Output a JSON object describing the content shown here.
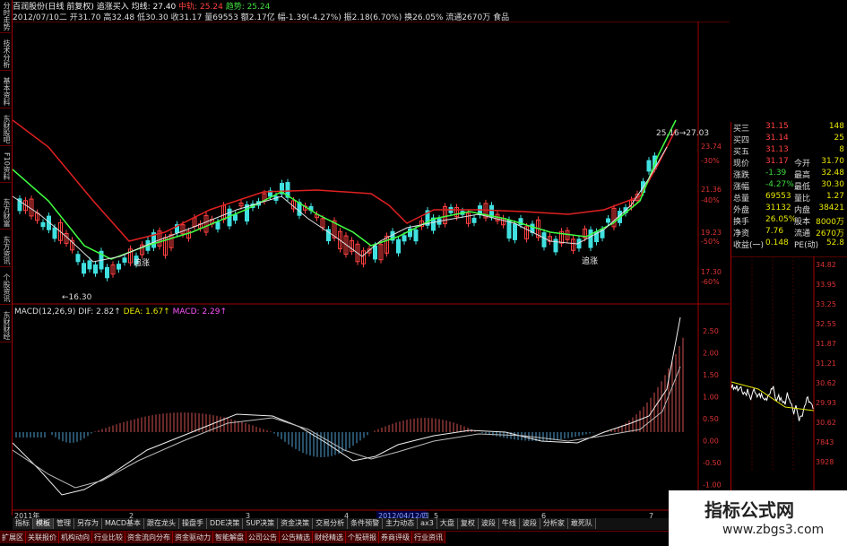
{
  "left_toolbar": [
    "分时走势",
    "技术分析",
    "基本资料",
    "东财股吧",
    "F10资料",
    "东方财富",
    "东方资讯",
    "个股资讯",
    "东财财经"
  ],
  "header": {
    "line1_parts": [
      {
        "text": "百润股份(日线 前复权)",
        "cls": "white"
      },
      {
        "text": " 追涨买入 ",
        "cls": "white"
      },
      {
        "text": "均线: 27.40",
        "cls": "white"
      },
      {
        "text": " 中轨: 25.24",
        "cls": "red"
      },
      {
        "text": " 趋势: 25.24",
        "cls": "green"
      }
    ],
    "line2": "2012/07/10二 开31.70 高32.48 低30.30 收31.17 量69553 额2.17亿 幅-1.39(-4.27%) 振2.18(6.70%) 换26.05% 流通2670万 食品"
  },
  "main_chart": {
    "price_axis": [
      "23.74",
      "-30%",
      "21.36",
      "-40%",
      "19.23",
      "-50%",
      "17.30",
      "-60%"
    ],
    "labels": {
      "low": "←16.30",
      "high": "25.16→27.03",
      "signal1": "追涨",
      "signal2": "追涨"
    }
  },
  "macd": {
    "title_parts": [
      {
        "text": "MACD(12,26,9) ",
        "cls": "white"
      },
      {
        "text": "DIF: 2.82↑ ",
        "cls": "white"
      },
      {
        "text": "DEA: 1.67↑ ",
        "cls": "yellow"
      },
      {
        "text": "MACD: 2.29↑",
        "cls": "magenta"
      }
    ],
    "axis": [
      "2.50",
      "2.00",
      "1.50",
      "1.00",
      "0.50",
      "0.00",
      "-0.50",
      "-1.00"
    ]
  },
  "time_axis": [
    "2011年",
    "2",
    "3",
    "4",
    "2012/04/12/四",
    "5",
    "6",
    "7"
  ],
  "quote": {
    "rows": [
      {
        "l": "买三",
        "v": "31.15",
        "v2": "",
        "v3": "148"
      },
      {
        "l": "买四",
        "v": "31.14",
        "v2": "",
        "v3": "25"
      },
      {
        "l": "买五",
        "v": "31.13",
        "v2": "",
        "v3": "8"
      },
      {
        "l": "现价",
        "v": "31.17",
        "v2": "今开",
        "v3": "31.70"
      },
      {
        "l": "涨跌",
        "v": "-1.39",
        "v2": "最高",
        "v3": "32.48"
      },
      {
        "l": "涨幅",
        "v": "-4.27%",
        "v2": "最低",
        "v3": "30.30"
      },
      {
        "l": "总量",
        "v": "69553",
        "v2": "量比",
        "v3": "1.27"
      },
      {
        "l": "外盘",
        "v": "31132",
        "v2": "内盘",
        "v3": "38421"
      },
      {
        "l": "换手",
        "v": "26.05%",
        "v2": "股本",
        "v3": "8000万"
      },
      {
        "l": "净资",
        "v": "7.76",
        "v2": "流通",
        "v3": "2670万"
      },
      {
        "l": "收益(一)",
        "v": "0.148",
        "v2": "PE(动)",
        "v3": "52.8"
      }
    ],
    "mini_axis": [
      "34.82",
      "33.95",
      "33.25",
      "32.55",
      "31.87",
      "31.21",
      "30.62",
      "29.93",
      "30.62",
      "7843",
      "3928"
    ]
  },
  "bottom_tabs1": [
    "指标",
    "模板",
    "管理",
    "另存为",
    "MACD基本",
    "跟在龙头",
    "操盘手",
    "DDE决策",
    "SUP决策",
    "资金决策",
    "交易分析",
    "条件预警",
    "主力动态",
    "ax3",
    "大盘",
    "复权",
    "波段",
    "牛线",
    "波段",
    "分析家",
    "敢死队"
  ],
  "bottom_tabs2": [
    "扩展区",
    "关联报价",
    "机构动向",
    "行业比较",
    "资金流向分布",
    "资金驱动力",
    "智能解盘",
    "公司公告",
    "公告精选",
    "财经精选",
    "个股研报",
    "券商评级",
    "行业资讯"
  ],
  "watermark": {
    "title": "指标公式网",
    "url": "www.zbgs3.com"
  },
  "colors": {
    "up": "#ff4040",
    "down": "#40e0e0",
    "ma_red": "#e02020",
    "ma_green": "#40ff40",
    "ma_white": "#e0e0e0",
    "axis_red": "#a00000"
  }
}
